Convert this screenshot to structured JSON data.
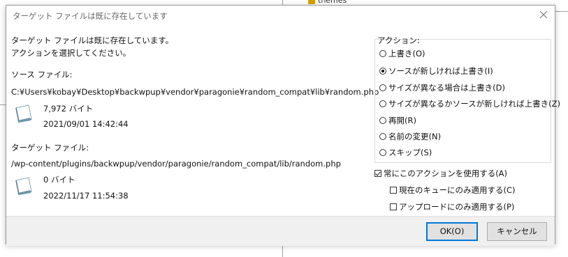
{
  "background": {
    "folder_label": "themes"
  },
  "dialog": {
    "title": "ターゲット ファイルは既に存在しています",
    "message_line1": "ターゲット ファイルは既に存在しています。",
    "message_line2": "アクションを選択してください。",
    "source": {
      "label": "ソース ファイル:",
      "path": "C:¥Users¥kobay¥Desktop¥backwpup¥vendor¥paragonie¥random_compat¥lib¥random.php",
      "size": "7,972 バイト",
      "date": "2021/09/01 14:42:44"
    },
    "target": {
      "label": "ターゲット ファイル:",
      "path": "/wp-content/plugins/backwpup/vendor/paragonie/random_compat/lib/random.php",
      "size": "0 バイト",
      "date": "2022/11/17 11:54:38"
    },
    "actions": {
      "label": "アクション:",
      "options": [
        {
          "label": "上書き(O)",
          "selected": false
        },
        {
          "label": "ソースが新しければ上書き(I)",
          "selected": true
        },
        {
          "label": "サイズが異なる場合は上書き(D)",
          "selected": false
        },
        {
          "label": "サイズが異なるかソースが新しければ上書き(Z)",
          "selected": false
        },
        {
          "label": "再開(R)",
          "selected": false
        },
        {
          "label": "名前の変更(N)",
          "selected": false
        },
        {
          "label": "スキップ(S)",
          "selected": false
        }
      ]
    },
    "checkboxes": [
      {
        "label": "常にこのアクションを使用する(A)",
        "checked": true
      },
      {
        "label": "現在のキューにのみ適用する(C)",
        "checked": false
      },
      {
        "label": "アップロードにのみ適用する(P)",
        "checked": false
      }
    ],
    "buttons": {
      "ok": "OK(O)",
      "cancel": "キャンセル"
    }
  },
  "colors": {
    "accent": "#0078d7",
    "footer_bg": "#f0f0f0",
    "button_bg": "#e1e1e1"
  }
}
